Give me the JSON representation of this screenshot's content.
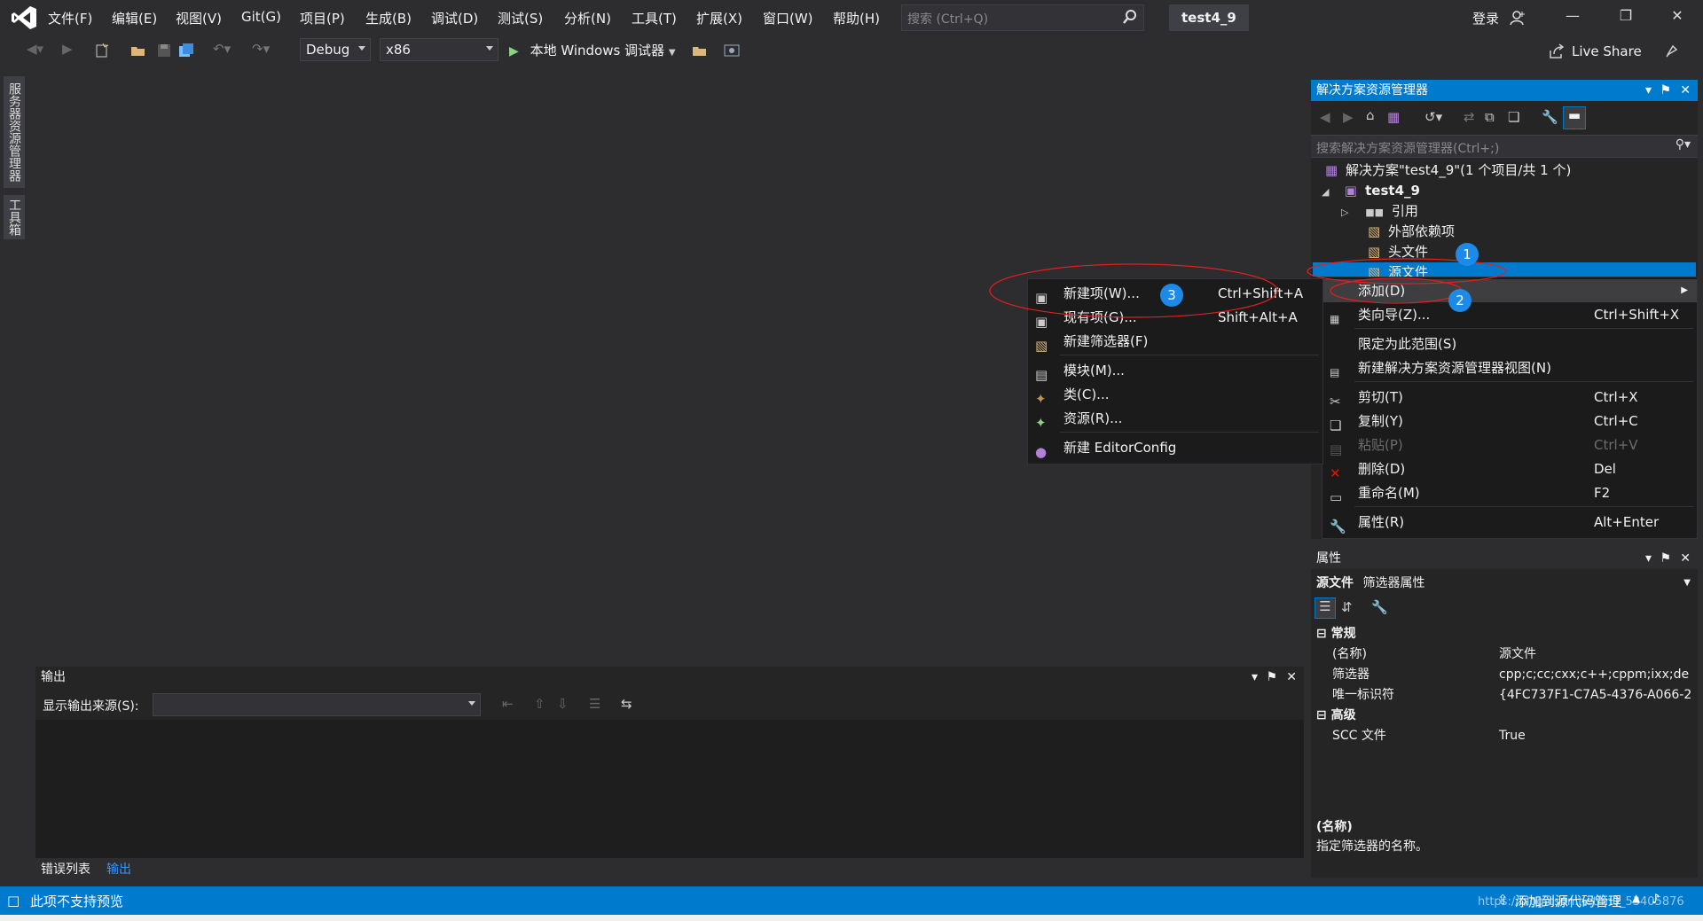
{
  "menu": [
    "文件(F)",
    "编辑(E)",
    "视图(V)",
    "Git(G)",
    "项目(P)",
    "生成(B)",
    "调试(D)",
    "测试(S)",
    "分析(N)",
    "工具(T)",
    "扩展(X)",
    "窗口(W)",
    "帮助(H)"
  ],
  "search": {
    "placeholder": "搜索 (Ctrl+Q)"
  },
  "project_title": "test4_9",
  "login": "登录",
  "live_share": "Live Share",
  "toolbar": {
    "config": "Debug",
    "platform": "x86",
    "run_label": "本地 Windows 调试器"
  },
  "side_tabs": {
    "server_explorer": "服务器资源管理器",
    "toolbox": "工具箱"
  },
  "solution_explorer": {
    "title": "解决方案资源管理器",
    "search_placeholder": "搜索解决方案资源管理器(Ctrl+;)",
    "solution": "解决方案\"test4_9\"(1 个项目/共 1 个)",
    "project": "test4_9",
    "nodes": [
      "引用",
      "外部依赖项",
      "头文件",
      "源文件"
    ]
  },
  "context_menu": {
    "items": [
      {
        "label": "添加(D)",
        "shortcut": ""
      },
      {
        "label": "类向导(Z)...",
        "shortcut": "Ctrl+Shift+X"
      },
      {
        "label": "限定为此范围(S)",
        "shortcut": ""
      },
      {
        "label": "新建解决方案资源管理器视图(N)",
        "shortcut": ""
      },
      {
        "label": "剪切(T)",
        "shortcut": "Ctrl+X"
      },
      {
        "label": "复制(Y)",
        "shortcut": "Ctrl+C"
      },
      {
        "label": "粘贴(P)",
        "shortcut": "Ctrl+V"
      },
      {
        "label": "删除(D)",
        "shortcut": "Del"
      },
      {
        "label": "重命名(M)",
        "shortcut": "F2"
      },
      {
        "label": "属性(R)",
        "shortcut": "Alt+Enter"
      }
    ]
  },
  "submenu": {
    "items": [
      {
        "label": "新建项(W)...",
        "shortcut": "Ctrl+Shift+A"
      },
      {
        "label": "现有项(G)...",
        "shortcut": "Shift+Alt+A"
      },
      {
        "label": "新建筛选器(F)",
        "shortcut": ""
      },
      {
        "label": "模块(M)...",
        "shortcut": ""
      },
      {
        "label": "类(C)...",
        "shortcut": ""
      },
      {
        "label": "资源(R)...",
        "shortcut": ""
      },
      {
        "label": "新建 EditorConfig",
        "shortcut": ""
      }
    ]
  },
  "badges": [
    "1",
    "2",
    "3"
  ],
  "properties": {
    "title": "属性",
    "object": "源文件",
    "object_type": "筛选器属性",
    "sections": [
      {
        "name": "常规",
        "rows": [
          [
            "(名称)",
            "源文件"
          ],
          [
            "筛选器",
            "cpp;c;cc;cxx;c++;cppm;ixx;de"
          ],
          [
            "唯一标识符",
            "{4FC737F1-C7A5-4376-A066-2"
          ]
        ]
      },
      {
        "name": "高级",
        "rows": [
          [
            "SCC 文件",
            "True"
          ]
        ]
      }
    ],
    "desc_title": "(名称)",
    "desc_text": "指定筛选器的名称。"
  },
  "output": {
    "title": "输出",
    "source_label": "显示输出来源(S):"
  },
  "bottom_tabs": [
    "错误列表",
    "输出"
  ],
  "status": {
    "text": "此项不支持预览",
    "source_control": "添加到源代码管理",
    "watermark": "https://blog.csdn.net/m0_53405876"
  },
  "colors": {
    "accent": "#007acc",
    "bg": "#2d2d30",
    "panel": "#252526",
    "badge": "#1e8ae8",
    "annotation": "#e02020"
  }
}
